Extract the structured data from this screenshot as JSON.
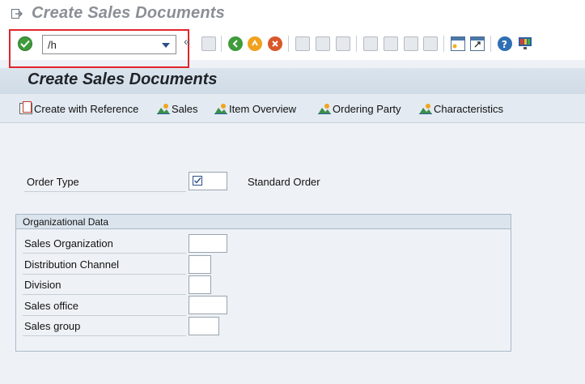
{
  "window": {
    "title": "Create Sales Documents"
  },
  "toolbar": {
    "command_value": "/h",
    "icons": [
      "exit-icon",
      "enter-check-icon",
      "command-dropdown-icon",
      "double-chevron-icon",
      "save-icon",
      "back-icon",
      "exit-app-icon",
      "cancel-icon",
      "print-icon",
      "find-icon",
      "find-next-icon",
      "first-page-icon",
      "previous-page-icon",
      "next-page-icon",
      "last-page-icon",
      "create-session-icon",
      "shortcut-icon",
      "help-icon",
      "customize-layout-icon"
    ]
  },
  "header": {
    "title": "Create Sales Documents"
  },
  "app_toolbar": {
    "create_with_reference": "Create with Reference",
    "sales": "Sales",
    "item_overview": "Item Overview",
    "ordering_party": "Ordering Party",
    "characteristics": "Characteristics"
  },
  "order_type": {
    "label": "Order Type",
    "value": "",
    "description": "Standard Order"
  },
  "org_data": {
    "title": "Organizational Data",
    "fields": [
      {
        "label": "Sales Organization",
        "value": ""
      },
      {
        "label": "Distribution Channel",
        "value": ""
      },
      {
        "label": "Division",
        "value": ""
      },
      {
        "label": "Sales office",
        "value": ""
      },
      {
        "label": "Sales group",
        "value": ""
      }
    ]
  },
  "colors": {
    "highlight": "#e0262b",
    "ok_green": "#3f9b3b",
    "header_band": "#dbe4ed"
  }
}
